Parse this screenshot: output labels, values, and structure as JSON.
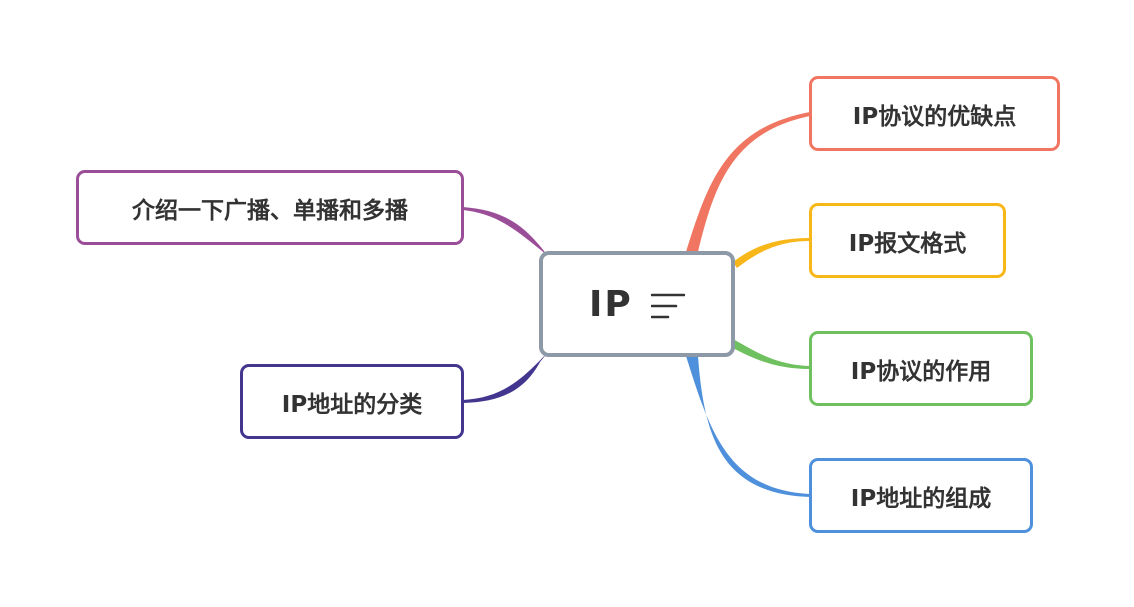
{
  "center": {
    "label": "IP",
    "border_color": "#8d99a6",
    "icon": "notes-lines-icon"
  },
  "topics": {
    "t1": {
      "label": "IP协议的优缺点",
      "color": "#f07662"
    },
    "t2": {
      "label": "IP报文格式",
      "color": "#f8b719"
    },
    "t3": {
      "label": "IP协议的作用",
      "color": "#6ec15e"
    },
    "t4": {
      "label": "IP地址的组成",
      "color": "#4e90db"
    },
    "t5": {
      "label": "介绍一下广播、单播和多播",
      "color": "#9b4e98"
    },
    "t6": {
      "label": "IP地址的分类",
      "color": "#42368f"
    }
  }
}
